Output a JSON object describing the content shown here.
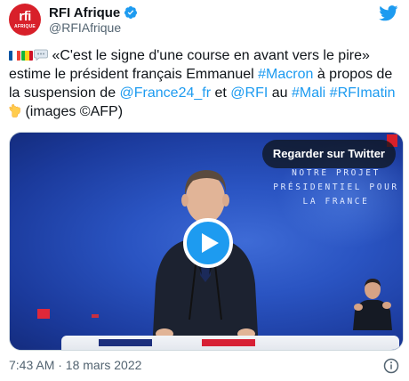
{
  "author": {
    "display_name": "RFI Afrique",
    "handle": "@RFIAfrique",
    "avatar_logo_text": "rfi",
    "avatar_logo_subtext": "AFRIQUE",
    "verified": true
  },
  "tweet": {
    "segments": [
      {
        "type": "emoji",
        "name": "flag-france-icon"
      },
      {
        "type": "emoji",
        "name": "flag-mali-icon"
      },
      {
        "type": "emoji",
        "name": "speech-bubble-icon"
      },
      {
        "type": "text",
        "text": " «C'est le signe d'une course en avant vers le pire» estime le président français Emmanuel "
      },
      {
        "type": "link",
        "text": "#Macron"
      },
      {
        "type": "text",
        "text": " à propos de la suspension de "
      },
      {
        "type": "link",
        "text": "@France24_fr"
      },
      {
        "type": "text",
        "text": " et "
      },
      {
        "type": "link",
        "text": "@RFI"
      },
      {
        "type": "text",
        "text": " au "
      },
      {
        "type": "link",
        "text": "#Mali"
      },
      {
        "type": "text",
        "text": " "
      },
      {
        "type": "link",
        "text": "#RFImatin"
      },
      {
        "type": "text",
        "text": " "
      },
      {
        "type": "emoji",
        "name": "pointing-down-icon"
      },
      {
        "type": "text",
        "text": " (images ©AFP)"
      }
    ]
  },
  "media": {
    "watch_button_label": "Regarder sur Twitter",
    "backdrop_text": [
      "NOTRE PROJET",
      "PRÉSIDENTIEL POUR",
      "LA FRANCE"
    ],
    "play_icon": "play-icon"
  },
  "footer": {
    "timestamp": "7:43 AM · 18 mars 2022",
    "info_icon": "info-icon"
  },
  "colors": {
    "link": "#1d9bf0",
    "twitter_blue": "#1d9bf0",
    "rfi_red": "#d8202a",
    "secondary_text": "#536471"
  }
}
